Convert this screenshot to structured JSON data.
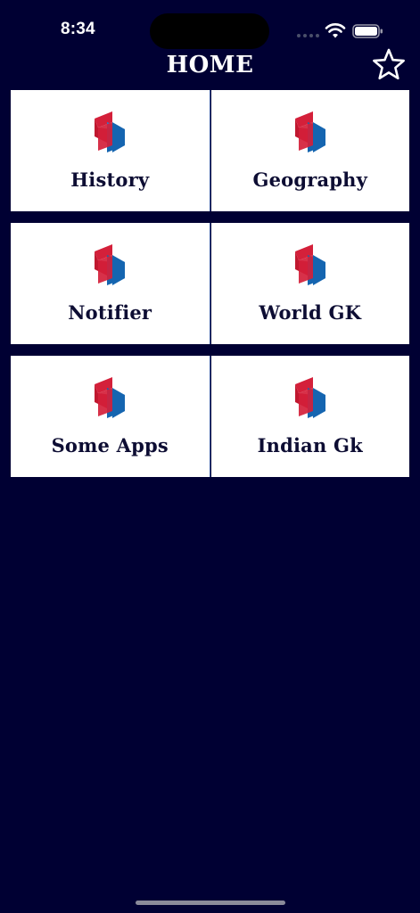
{
  "status_bar": {
    "time": "8:34"
  },
  "header": {
    "title": "HOME",
    "favorite_icon": "star-outline-icon"
  },
  "tiles": [
    {
      "label": "History",
      "icon": "app-logo-icon"
    },
    {
      "label": "Geography",
      "icon": "app-logo-icon"
    },
    {
      "label": "Notifier",
      "icon": "app-logo-icon"
    },
    {
      "label": "World GK",
      "icon": "app-logo-icon"
    },
    {
      "label": "Some Apps",
      "icon": "app-logo-icon"
    },
    {
      "label": "Indian Gk",
      "icon": "app-logo-icon"
    }
  ],
  "colors": {
    "background": "#000033",
    "tile": "#ffffff",
    "logo_red": "#d4203a",
    "logo_blue": "#1565b0",
    "label_text": "#0d0d33"
  }
}
